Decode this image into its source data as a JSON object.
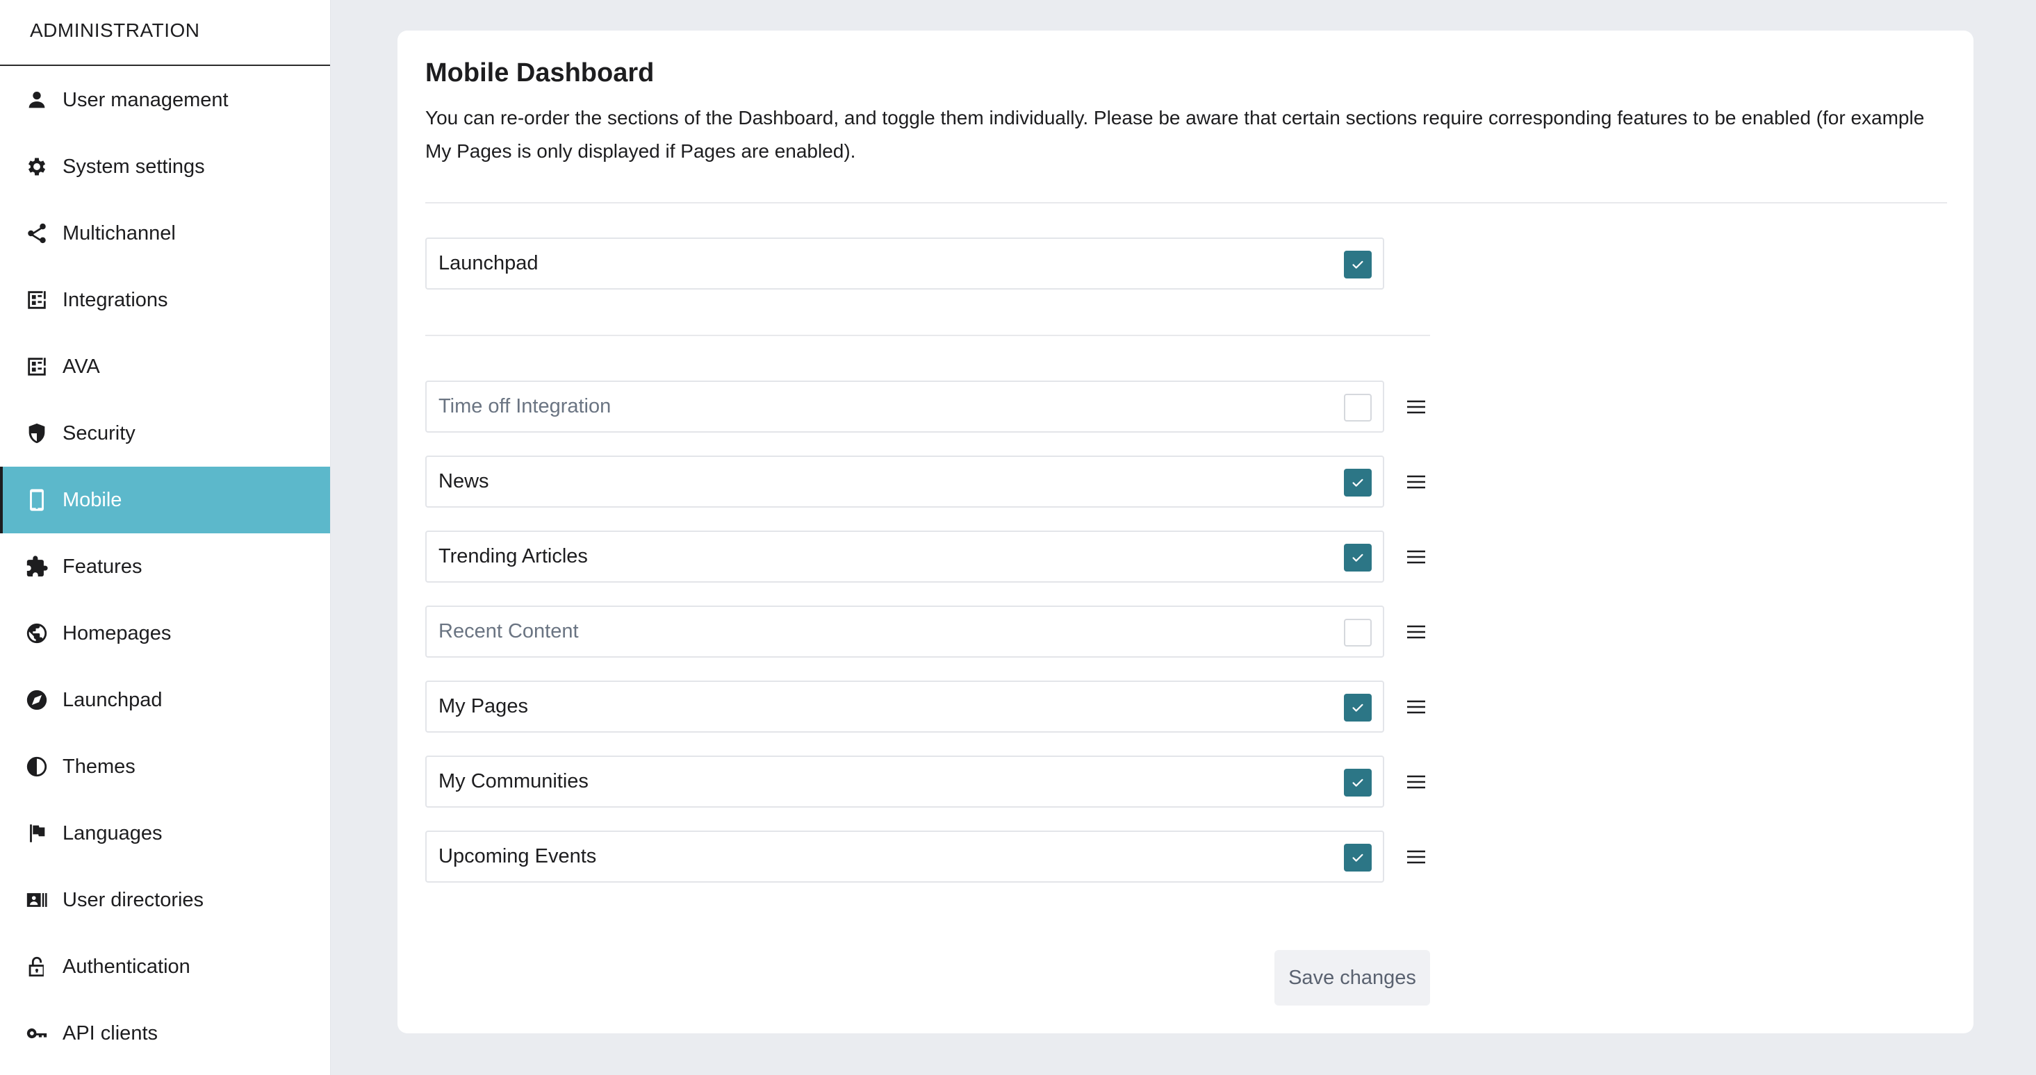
{
  "sidebar": {
    "header": "ADMINISTRATION",
    "items": [
      {
        "label": "User management",
        "icon": "person-icon"
      },
      {
        "label": "System settings",
        "icon": "gear-icon"
      },
      {
        "label": "Multichannel",
        "icon": "share-icon"
      },
      {
        "label": "Integrations",
        "icon": "integrations-icon"
      },
      {
        "label": "AVA",
        "icon": "ava-icon"
      },
      {
        "label": "Security",
        "icon": "shield-icon"
      },
      {
        "label": "Mobile",
        "icon": "phone-icon",
        "active": true
      },
      {
        "label": "Features",
        "icon": "puzzle-icon"
      },
      {
        "label": "Homepages",
        "icon": "globe-icon"
      },
      {
        "label": "Launchpad",
        "icon": "compass-icon"
      },
      {
        "label": "Themes",
        "icon": "contrast-icon"
      },
      {
        "label": "Languages",
        "icon": "flag-icon"
      },
      {
        "label": "User directories",
        "icon": "directory-icon"
      },
      {
        "label": "Authentication",
        "icon": "lock-icon"
      },
      {
        "label": "API clients",
        "icon": "key-icon"
      }
    ]
  },
  "main": {
    "title": "Mobile Dashboard",
    "description": "You can re-order the sections of the Dashboard, and toggle them individually. Please be aware that certain sections require corresponding features to be enabled (for example My Pages is only displayed if Pages are enabled).",
    "pinned_section": {
      "label": "Launchpad",
      "checked": true
    },
    "sections": [
      {
        "label": "Time off Integration",
        "checked": false
      },
      {
        "label": "News",
        "checked": true
      },
      {
        "label": "Trending Articles",
        "checked": true
      },
      {
        "label": "Recent Content",
        "checked": false
      },
      {
        "label": "My Pages",
        "checked": true
      },
      {
        "label": "My Communities",
        "checked": true
      },
      {
        "label": "Upcoming Events",
        "checked": true
      }
    ],
    "save_label": "Save changes"
  },
  "colors": {
    "accent": "#5cb8cb",
    "checkbox_checked": "#2c7686",
    "page_background": "#eaecf0"
  }
}
